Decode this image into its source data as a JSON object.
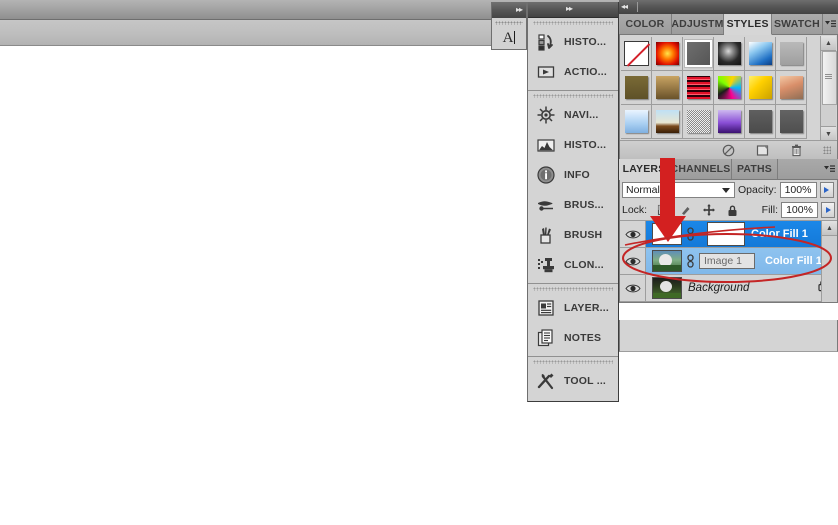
{
  "app": {
    "title_bar_present": true,
    "accent_selected": "#1b87e8",
    "accent_selected_light": "#8fc3ef",
    "annotation_color": "#cc2222"
  },
  "tool_preset_flyout": {
    "name": "tool-preset-flyout",
    "glyph": "A",
    "collapse_chevron": "▸▸"
  },
  "icon_dock": {
    "collapse_chevron": "▸▸",
    "groups": [
      {
        "items": [
          {
            "label": "HISTO...",
            "icon": "history-icon"
          },
          {
            "label": "ACTIO...",
            "icon": "actions-play-icon"
          }
        ]
      },
      {
        "items": [
          {
            "label": "NAVI...",
            "icon": "navigator-wheel-icon"
          },
          {
            "label": "HISTO...",
            "icon": "histogram-icon"
          },
          {
            "label": "INFO",
            "icon": "info-circle-icon"
          },
          {
            "label": "BRUS...",
            "icon": "brush-presets-icon"
          },
          {
            "label": "BRUSH",
            "icon": "brush-icon"
          },
          {
            "label": "CLON...",
            "icon": "clone-source-icon"
          }
        ]
      },
      {
        "items": [
          {
            "label": "LAYER...",
            "icon": "layer-comps-icon"
          },
          {
            "label": "NOTES",
            "icon": "notes-icon"
          }
        ]
      },
      {
        "items": [
          {
            "label": "TOOL ...",
            "icon": "tool-presets-icon"
          }
        ]
      }
    ]
  },
  "right_dock": {
    "collapse_chevron": "◂◂",
    "styles_group": {
      "tabs": [
        {
          "label": "COLOR",
          "active": false
        },
        {
          "label": "ADJUSTM",
          "active": false
        },
        {
          "label": "STYLES",
          "active": true
        },
        {
          "label": "SWATCH",
          "active": false
        }
      ],
      "menu_glyph": "▾☰",
      "swatches": [
        {
          "name": "none",
          "kind": "none",
          "selected": false
        },
        {
          "name": "red-glow",
          "css": "radial-gradient(circle at 50% 50%, #ffe54a 0%, #ff7a00 35%, #e01000 70%, #7b0000 100%)",
          "selected": false
        },
        {
          "name": "gray-bevel",
          "css": "linear-gradient(135deg,#6e6e6e,#565656)",
          "selected": true
        },
        {
          "name": "dark-ring",
          "css": "radial-gradient(circle at 45% 40%, #d8d8d8 0%, #8a8a8a 25%, #2a2a2a 60%, #121212 100%)",
          "selected": false
        },
        {
          "name": "blue-sky",
          "css": "linear-gradient(150deg,#ffffff 0%,#8cc8f0 35%,#1f6fc4 75%,#0d3f83 100%)",
          "selected": false
        },
        {
          "name": "flat-gray",
          "css": "linear-gradient(180deg,#b9b9b9,#9f9f9f)",
          "selected": false
        },
        {
          "name": "olive-brown",
          "css": "linear-gradient(180deg,#7a6a36,#5e5128)",
          "selected": false
        },
        {
          "name": "tan-gradient",
          "css": "linear-gradient(180deg,#c9a463,#6a522a)",
          "selected": false
        },
        {
          "name": "red-stripes",
          "css": "repeating-linear-gradient(0deg,#e01028 0 2px,#2a0008 2px 4px,#ff5f6e 4px 5px)",
          "selected": false
        },
        {
          "name": "rainbow-abstract",
          "css": "conic-gradient(from 20deg,#ffd400,#00b7ff,#ff0090,#1b1b1b,#7cff00,#ffd400)",
          "selected": false
        },
        {
          "name": "yellow-bevel",
          "css": "linear-gradient(135deg,#fff06a 0%,#ffd000 40%,#caa100 100%)",
          "selected": false
        },
        {
          "name": "peach-fade",
          "css": "linear-gradient(160deg,#f3c9a6 0%,#d98f6a 45%,#8f6e55 100%)",
          "selected": false
        },
        {
          "name": "light-blue-fade",
          "css": "linear-gradient(180deg,#eaf4ff 0%,#a9cff2 60%,#7fb0e0 100%)",
          "selected": false
        },
        {
          "name": "sunset-horizon",
          "css": "linear-gradient(180deg,#bfe0f5 0%,#e8e6d2 55%,#7a4a1c 70%,#3a2008 100%)",
          "selected": false
        },
        {
          "name": "noise-speckle",
          "css": "repeating-conic-gradient(#f0f0f0 0% 25%,#8a8a8a 0% 50%)",
          "selected": false
        },
        {
          "name": "purple-bevel",
          "css": "linear-gradient(180deg,#cdb8ef 0%,#8a4fd6 55%,#3a1270 100%)",
          "selected": false
        },
        {
          "name": "dark-gray-1",
          "css": "linear-gradient(180deg,#5f5f5f,#4b4b4b)",
          "selected": false
        },
        {
          "name": "dark-gray-2",
          "css": "linear-gradient(180deg,#636363,#4f4f4f)",
          "selected": false
        }
      ],
      "footer_icons": [
        {
          "name": "clear-style-icon",
          "glyph": "⃠"
        },
        {
          "name": "new-style-icon",
          "glyph": "▣"
        },
        {
          "name": "delete-style-icon",
          "glyph": "🗑"
        }
      ]
    },
    "layers_group": {
      "tabs": [
        {
          "label": "LAYERS",
          "active": true
        },
        {
          "label": "CHANNELS",
          "active": false
        },
        {
          "label": "PATHS",
          "active": false
        }
      ],
      "menu_glyph": "▾☰",
      "blend_mode": "Normal",
      "opacity_label": "Opacity:",
      "opacity_value": "100%",
      "lock_label": "Lock:",
      "fill_label": "Fill:",
      "fill_value": "100%",
      "lock_icons": [
        {
          "name": "lock-transparent-pixels-icon",
          "glyph": "▥"
        },
        {
          "name": "lock-image-pixels-icon",
          "glyph": "🖌"
        },
        {
          "name": "lock-position-icon",
          "glyph": "✛"
        },
        {
          "name": "lock-all-icon",
          "glyph": "🔒"
        }
      ],
      "layers": [
        {
          "name": "Color Fill 1",
          "visible": true,
          "selected": "strong",
          "thumb": "white-solid",
          "has_mask": true,
          "linked": true,
          "editing": false,
          "locked": false
        },
        {
          "name": "Color Fill 1",
          "visible": true,
          "selected": "light",
          "thumb": "photo",
          "has_mask": false,
          "linked": true,
          "editing": true,
          "edit_value": "Image 1",
          "locked": false
        },
        {
          "name": "Background",
          "visible": true,
          "selected": "none",
          "thumb": "photo",
          "has_mask": false,
          "linked": false,
          "editing": false,
          "locked": true,
          "lock_icon": "lock-icon"
        }
      ]
    }
  },
  "annotations": [
    {
      "name": "red-down-arrow",
      "target": "layer-mask-thumbnail"
    },
    {
      "name": "red-ellipse-highlight",
      "target": "layer-name-edit-row"
    }
  ]
}
